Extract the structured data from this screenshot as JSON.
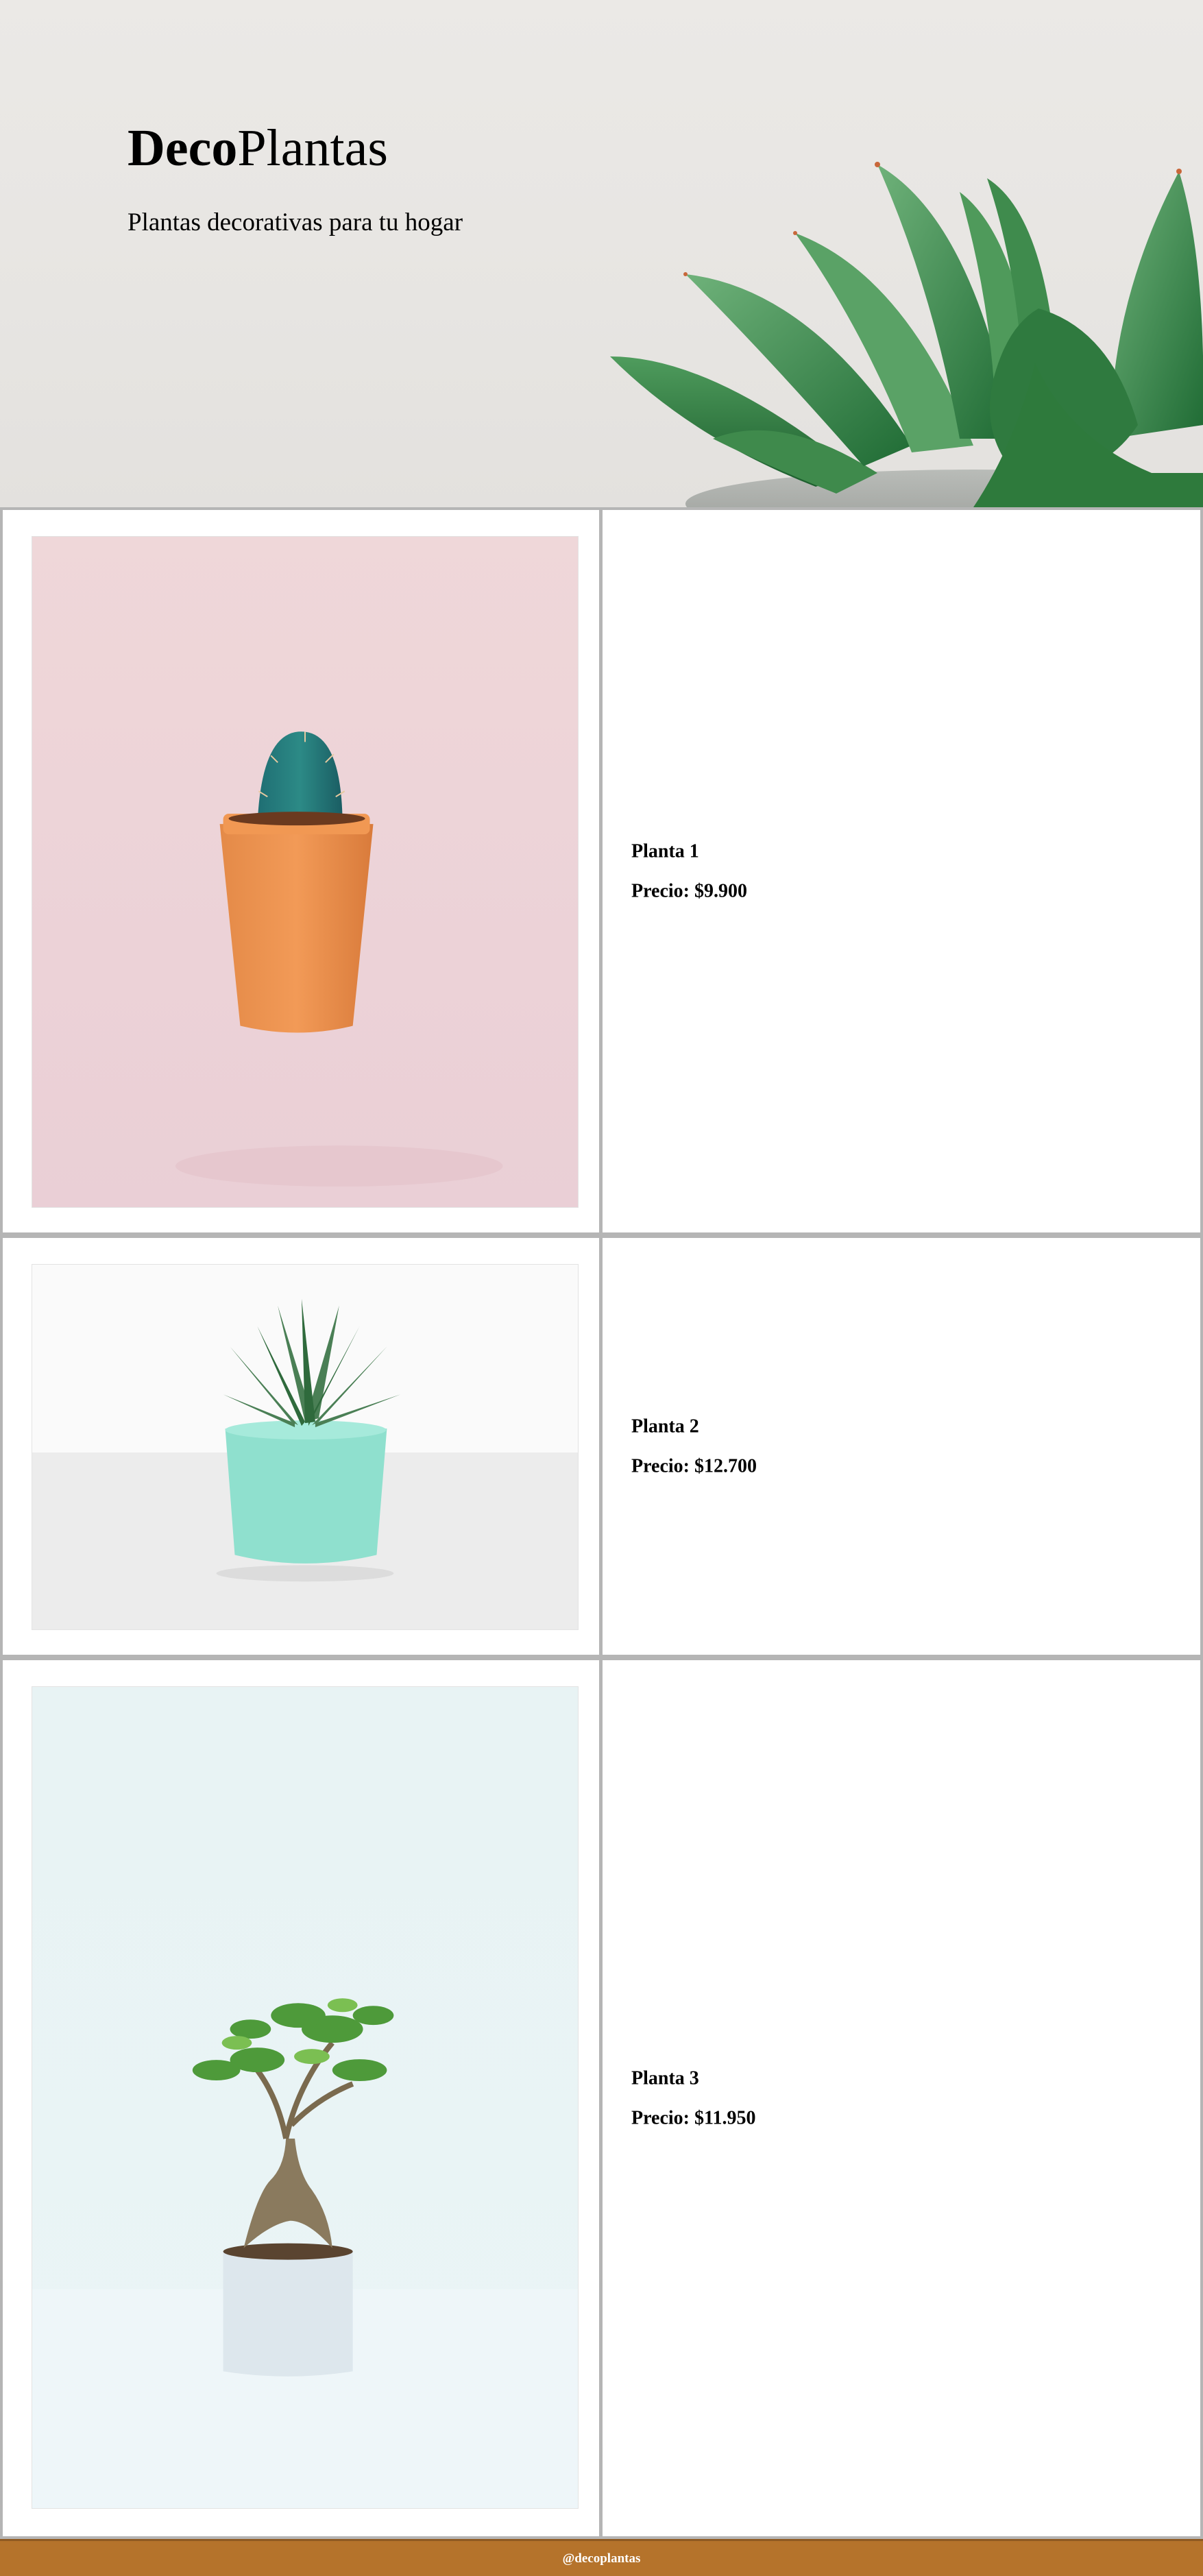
{
  "header": {
    "brand_bold": "Deco",
    "brand_regular": "Plantas",
    "subtitle": "Plantas decorativas para tu hogar"
  },
  "products": [
    {
      "name": "Planta 1",
      "price": "Precio: $9.900"
    },
    {
      "name": "Planta 2",
      "price": "Precio: $12.700"
    },
    {
      "name": "Planta 3",
      "price": "Precio: $11.950"
    }
  ],
  "footer": {
    "handle": "@decoplantas"
  },
  "colors": {
    "footer_bg": "#b5732b",
    "border": "#b5b5b5",
    "hero_bg": "#e8e6e3"
  },
  "icons": [
    "succulent-hero-image",
    "cactus-photo",
    "succulent-photo",
    "bonsai-photo"
  ]
}
